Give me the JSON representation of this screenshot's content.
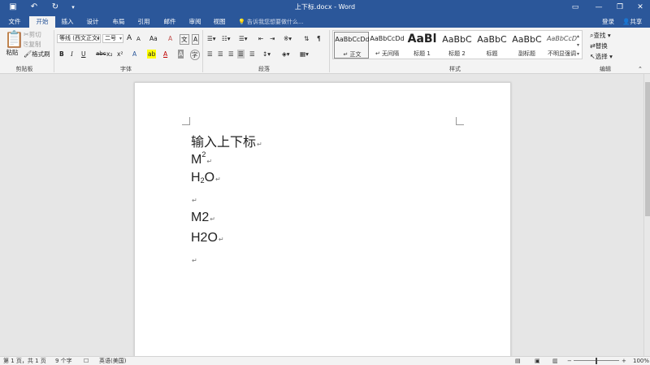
{
  "window": {
    "title": "上下标.docx - Word",
    "controls": [
      "▭",
      "—",
      "❐",
      "✕"
    ]
  },
  "tabs": [
    "文件",
    "开始",
    "插入",
    "设计",
    "布局",
    "引用",
    "邮件",
    "审阅",
    "视图"
  ],
  "active_tab": "开始",
  "tell_me_placeholder": "告诉我您想要做什么...",
  "account": {
    "login": "登录",
    "share": "共享"
  },
  "ribbon": {
    "clipboard": {
      "label": "剪贴板",
      "paste": "粘贴",
      "cut": "剪切",
      "copy": "复制",
      "format_painter": "格式刷"
    },
    "font": {
      "label": "字体",
      "name": "等线 (西文正文)",
      "size": "二号",
      "grow": "A",
      "shrink": "A",
      "case": "Aa",
      "bold": "B",
      "italic": "I",
      "underline": "U",
      "strike": "abc",
      "subscript": "x₂",
      "superscript": "x²"
    },
    "paragraph": {
      "label": "段落"
    },
    "styles": {
      "label": "样式",
      "items": [
        {
          "preview": "AaBbCcDd",
          "name": "↵ 正文"
        },
        {
          "preview": "AaBbCcDd",
          "name": "↵ 无间隔"
        },
        {
          "preview": "AaBl",
          "name": "标题 1"
        },
        {
          "preview": "AaBbC",
          "name": "标题 2"
        },
        {
          "preview": "AaBbC",
          "name": "标题"
        },
        {
          "preview": "AaBbC",
          "name": "副标题"
        },
        {
          "preview": "AaBbCcD",
          "name": "不明显强调"
        }
      ]
    },
    "editing": {
      "label": "编辑",
      "find": "查找",
      "replace": "替换",
      "select": "选择"
    }
  },
  "document": {
    "heading": "输入上下标",
    "line_superscript": {
      "base": "M",
      "sup": "2"
    },
    "line_subscript": {
      "pre": "H",
      "sub": "2",
      "post": "O"
    },
    "plain_1": "M2",
    "plain_2": "H2O",
    "pilcrow": "↵"
  },
  "status": {
    "page": "第 1 页，共 1 页",
    "words": "9 个字",
    "language": "英语(美国)",
    "zoom": "100%"
  }
}
